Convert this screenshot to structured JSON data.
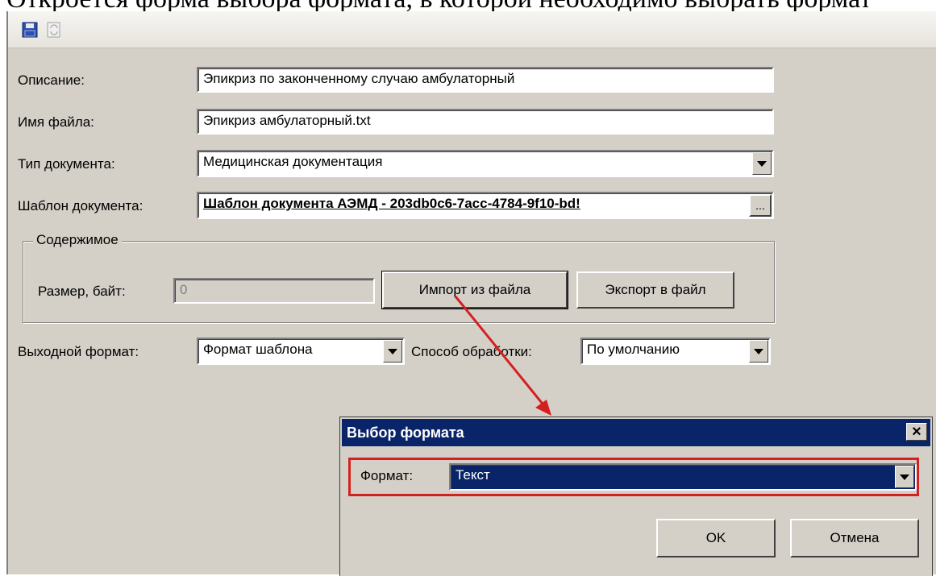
{
  "intro_text": "Откроется форма выбора формата, в которой необходимо выбрать формат",
  "toolbar": {
    "save_icon": "floppy-disk-icon",
    "refresh_icon": "refresh-icon"
  },
  "form": {
    "description_label": "Описание:",
    "description_value": "Эпикриз по законченному случаю амбулаторный",
    "filename_label": "Имя файла:",
    "filename_value": "Эпикриз амбулаторный.txt",
    "doctype_label": "Тип документа:",
    "doctype_value": "Медицинская документация",
    "template_label": "Шаблон документа:",
    "template_value": "Шаблон документа АЭМД - 203db0c6-7acc-4784-9f10-bd!",
    "browse_label": "...",
    "content_group_title": "Содержимое",
    "size_label": "Размер, байт:",
    "size_value": "0",
    "import_button": "Импорт из файла",
    "export_button": "Экспорт в файл",
    "output_format_label": "Выходной формат:",
    "output_format_value": "Формат шаблона",
    "processing_label": "Способ обработки:",
    "processing_value": "По умолчанию"
  },
  "dialog": {
    "title": "Выбор формата",
    "close_symbol": "×",
    "format_label": "Формат:",
    "format_value": "Текст",
    "ok_button": "OK",
    "cancel_button": "Отмена"
  },
  "colors": {
    "dialog_title_bg": "#0a246a",
    "highlight_red": "#d42020",
    "window_bg": "#d4d0c8"
  }
}
